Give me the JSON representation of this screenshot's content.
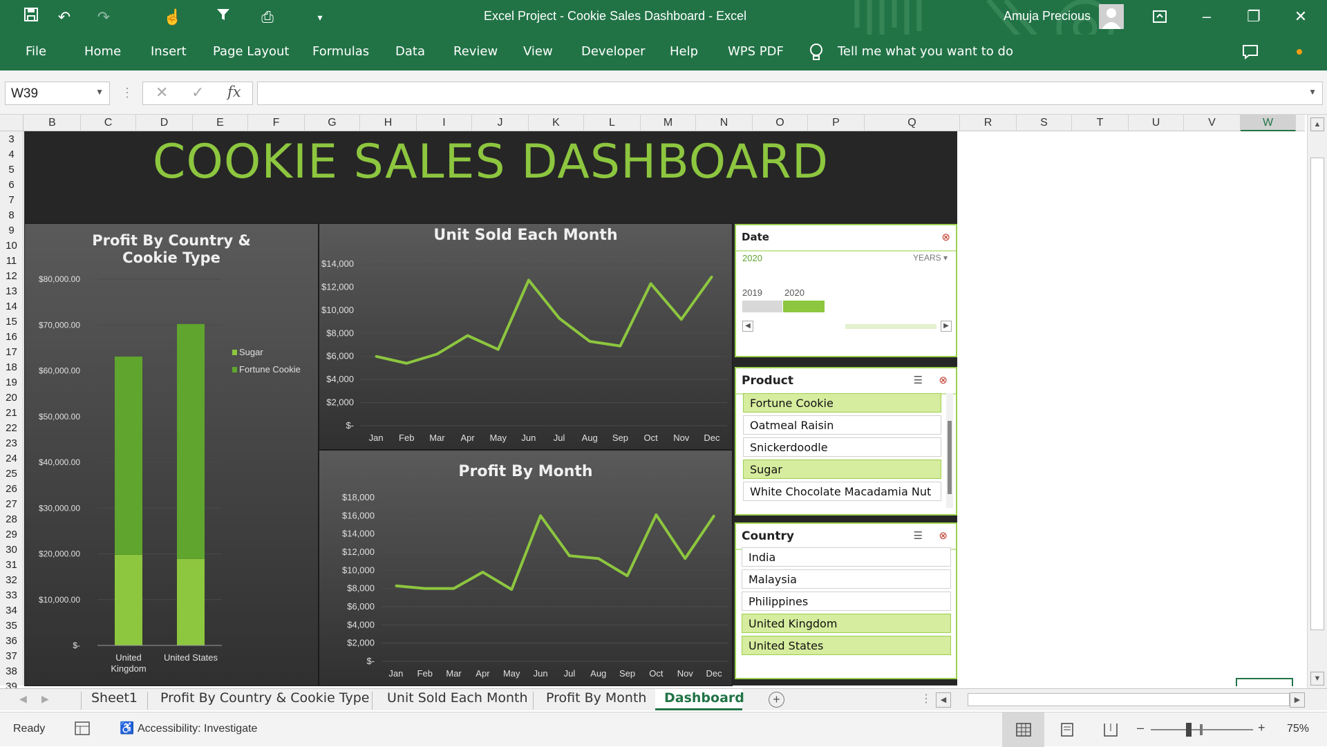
{
  "window": {
    "title": "Excel Project - Cookie Sales Dashboard  -  Excel",
    "user": "Amuja Precious"
  },
  "ribbon": {
    "tabs": [
      "File",
      "Home",
      "Insert",
      "Page Layout",
      "Formulas",
      "Data",
      "Review",
      "View",
      "Developer",
      "Help",
      "WPS PDF"
    ],
    "tell_me": "Tell me what you want to do"
  },
  "formula_bar": {
    "name_box": "W39",
    "formula": ""
  },
  "grid": {
    "columns": [
      "B",
      "C",
      "D",
      "E",
      "F",
      "G",
      "H",
      "I",
      "J",
      "K",
      "L",
      "M",
      "N",
      "O",
      "P",
      "Q",
      "R",
      "S",
      "T",
      "U",
      "V",
      "W"
    ],
    "rows": [
      "3",
      "4",
      "5",
      "6",
      "7",
      "8",
      "9",
      "10",
      "11",
      "12",
      "13",
      "14",
      "15",
      "16",
      "17",
      "18",
      "19",
      "20",
      "21",
      "22",
      "23",
      "24",
      "25",
      "26",
      "27",
      "28",
      "29",
      "30",
      "31",
      "32",
      "33",
      "34",
      "35",
      "36",
      "37",
      "38",
      "39"
    ]
  },
  "dashboard": {
    "title": "COOKIE SALES DASHBOARD"
  },
  "chart_data": [
    {
      "type": "bar",
      "title": "Profit By Country & Cookie Type",
      "stacked": true,
      "categories": [
        "United Kingdom",
        "United States"
      ],
      "series": [
        {
          "name": "Sugar",
          "values": [
            19800,
            18900
          ]
        },
        {
          "name": "Fortune Cookie",
          "values": [
            43300,
            51300
          ]
        }
      ],
      "y_ticks": [
        "$-",
        "$10,000.00",
        "$20,000.00",
        "$30,000.00",
        "$40,000.00",
        "$50,000.00",
        "$60,000.00",
        "$70,000.00",
        "$80,000.00"
      ],
      "ylim": [
        0,
        80000
      ],
      "legend_position": "right",
      "colors": {
        "Sugar": "#8dc63f",
        "Fortune Cookie": "#5fa52e"
      }
    },
    {
      "type": "line",
      "title": "Unit Sold Each Month",
      "x": [
        "Jan",
        "Feb",
        "Mar",
        "Apr",
        "May",
        "Jun",
        "Jul",
        "Aug",
        "Sep",
        "Oct",
        "Nov",
        "Dec"
      ],
      "values": [
        6000,
        5400,
        6200,
        7800,
        6600,
        12600,
        9300,
        7300,
        6900,
        12300,
        9200,
        12900
      ],
      "y_ticks": [
        "$-",
        "$2,000",
        "$4,000",
        "$6,000",
        "$8,000",
        "$10,000",
        "$12,000",
        "$14,000"
      ],
      "ylim": [
        0,
        14000
      ],
      "color": "#8dc63f"
    },
    {
      "type": "line",
      "title": "Profit By Month",
      "x": [
        "Jan",
        "Feb",
        "Mar",
        "Apr",
        "May",
        "Jun",
        "Jul",
        "Aug",
        "Sep",
        "Oct",
        "Nov",
        "Dec"
      ],
      "values": [
        8300,
        8000,
        8000,
        9800,
        7900,
        16000,
        11600,
        11300,
        9400,
        16100,
        11300,
        16000
      ],
      "y_ticks": [
        "$-",
        "$2,000",
        "$4,000",
        "$6,000",
        "$8,000",
        "$10,000",
        "$12,000",
        "$14,000",
        "$16,000",
        "$18,000"
      ],
      "ylim": [
        0,
        18000
      ],
      "color": "#8dc63f"
    }
  ],
  "slicers": {
    "date": {
      "title": "Date",
      "selected": "2020",
      "level": "YEARS",
      "years": [
        "2019",
        "2020"
      ],
      "selected_year": "2020"
    },
    "product": {
      "title": "Product",
      "items": [
        {
          "label": "Fortune Cookie",
          "selected": true
        },
        {
          "label": "Oatmeal Raisin",
          "selected": false
        },
        {
          "label": "Snickerdoodle",
          "selected": false
        },
        {
          "label": "Sugar",
          "selected": true
        },
        {
          "label": "White Chocolate Macadamia Nut",
          "selected": false
        }
      ]
    },
    "country": {
      "title": "Country",
      "items": [
        {
          "label": "India",
          "selected": false
        },
        {
          "label": "Malaysia",
          "selected": false
        },
        {
          "label": "Philippines",
          "selected": false
        },
        {
          "label": "United Kingdom",
          "selected": true
        },
        {
          "label": "United States",
          "selected": true
        }
      ]
    }
  },
  "sheet_tabs": {
    "tabs": [
      "Sheet1",
      "Profit By Country & Cookie Type",
      "Unit Sold Each Month",
      "Profit By Month",
      "Dashboard"
    ],
    "active": "Dashboard"
  },
  "status": {
    "ready": "Ready",
    "accessibility": "Accessibility: Investigate",
    "zoom": "75%"
  },
  "colors": {
    "excel_green": "#217346",
    "accent": "#8dc63f",
    "dashboard_bg": "#262626"
  }
}
